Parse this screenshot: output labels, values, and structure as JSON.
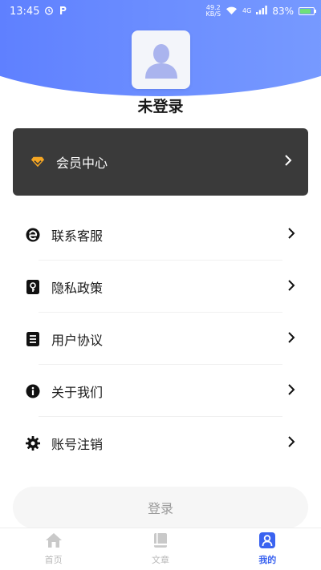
{
  "status_bar": {
    "time": "13:45",
    "net_speed_value": "49.2",
    "net_speed_unit": "KB/S",
    "network": "4G",
    "battery": "83%",
    "battery_level": 0.83
  },
  "profile": {
    "name": "未登录"
  },
  "vip": {
    "label": "会员中心"
  },
  "menu": {
    "items": [
      {
        "label": "联系客服",
        "icon": "customer-service-icon"
      },
      {
        "label": "隐私政策",
        "icon": "privacy-icon"
      },
      {
        "label": "用户协议",
        "icon": "document-icon"
      },
      {
        "label": "关于我们",
        "icon": "info-icon"
      },
      {
        "label": "账号注销",
        "icon": "gear-icon"
      }
    ]
  },
  "login_button": {
    "label": "登录"
  },
  "tabs": [
    {
      "label": "首页",
      "icon": "home-icon",
      "active": false
    },
    {
      "label": "文章",
      "icon": "book-icon",
      "active": false
    },
    {
      "label": "我的",
      "icon": "profile-icon",
      "active": true
    }
  ],
  "colors": {
    "header_blue": "#6a8cff",
    "vip_card": "#3a3a3a",
    "vip_icon": "#f5a623",
    "active_tab": "#3a63f0"
  }
}
